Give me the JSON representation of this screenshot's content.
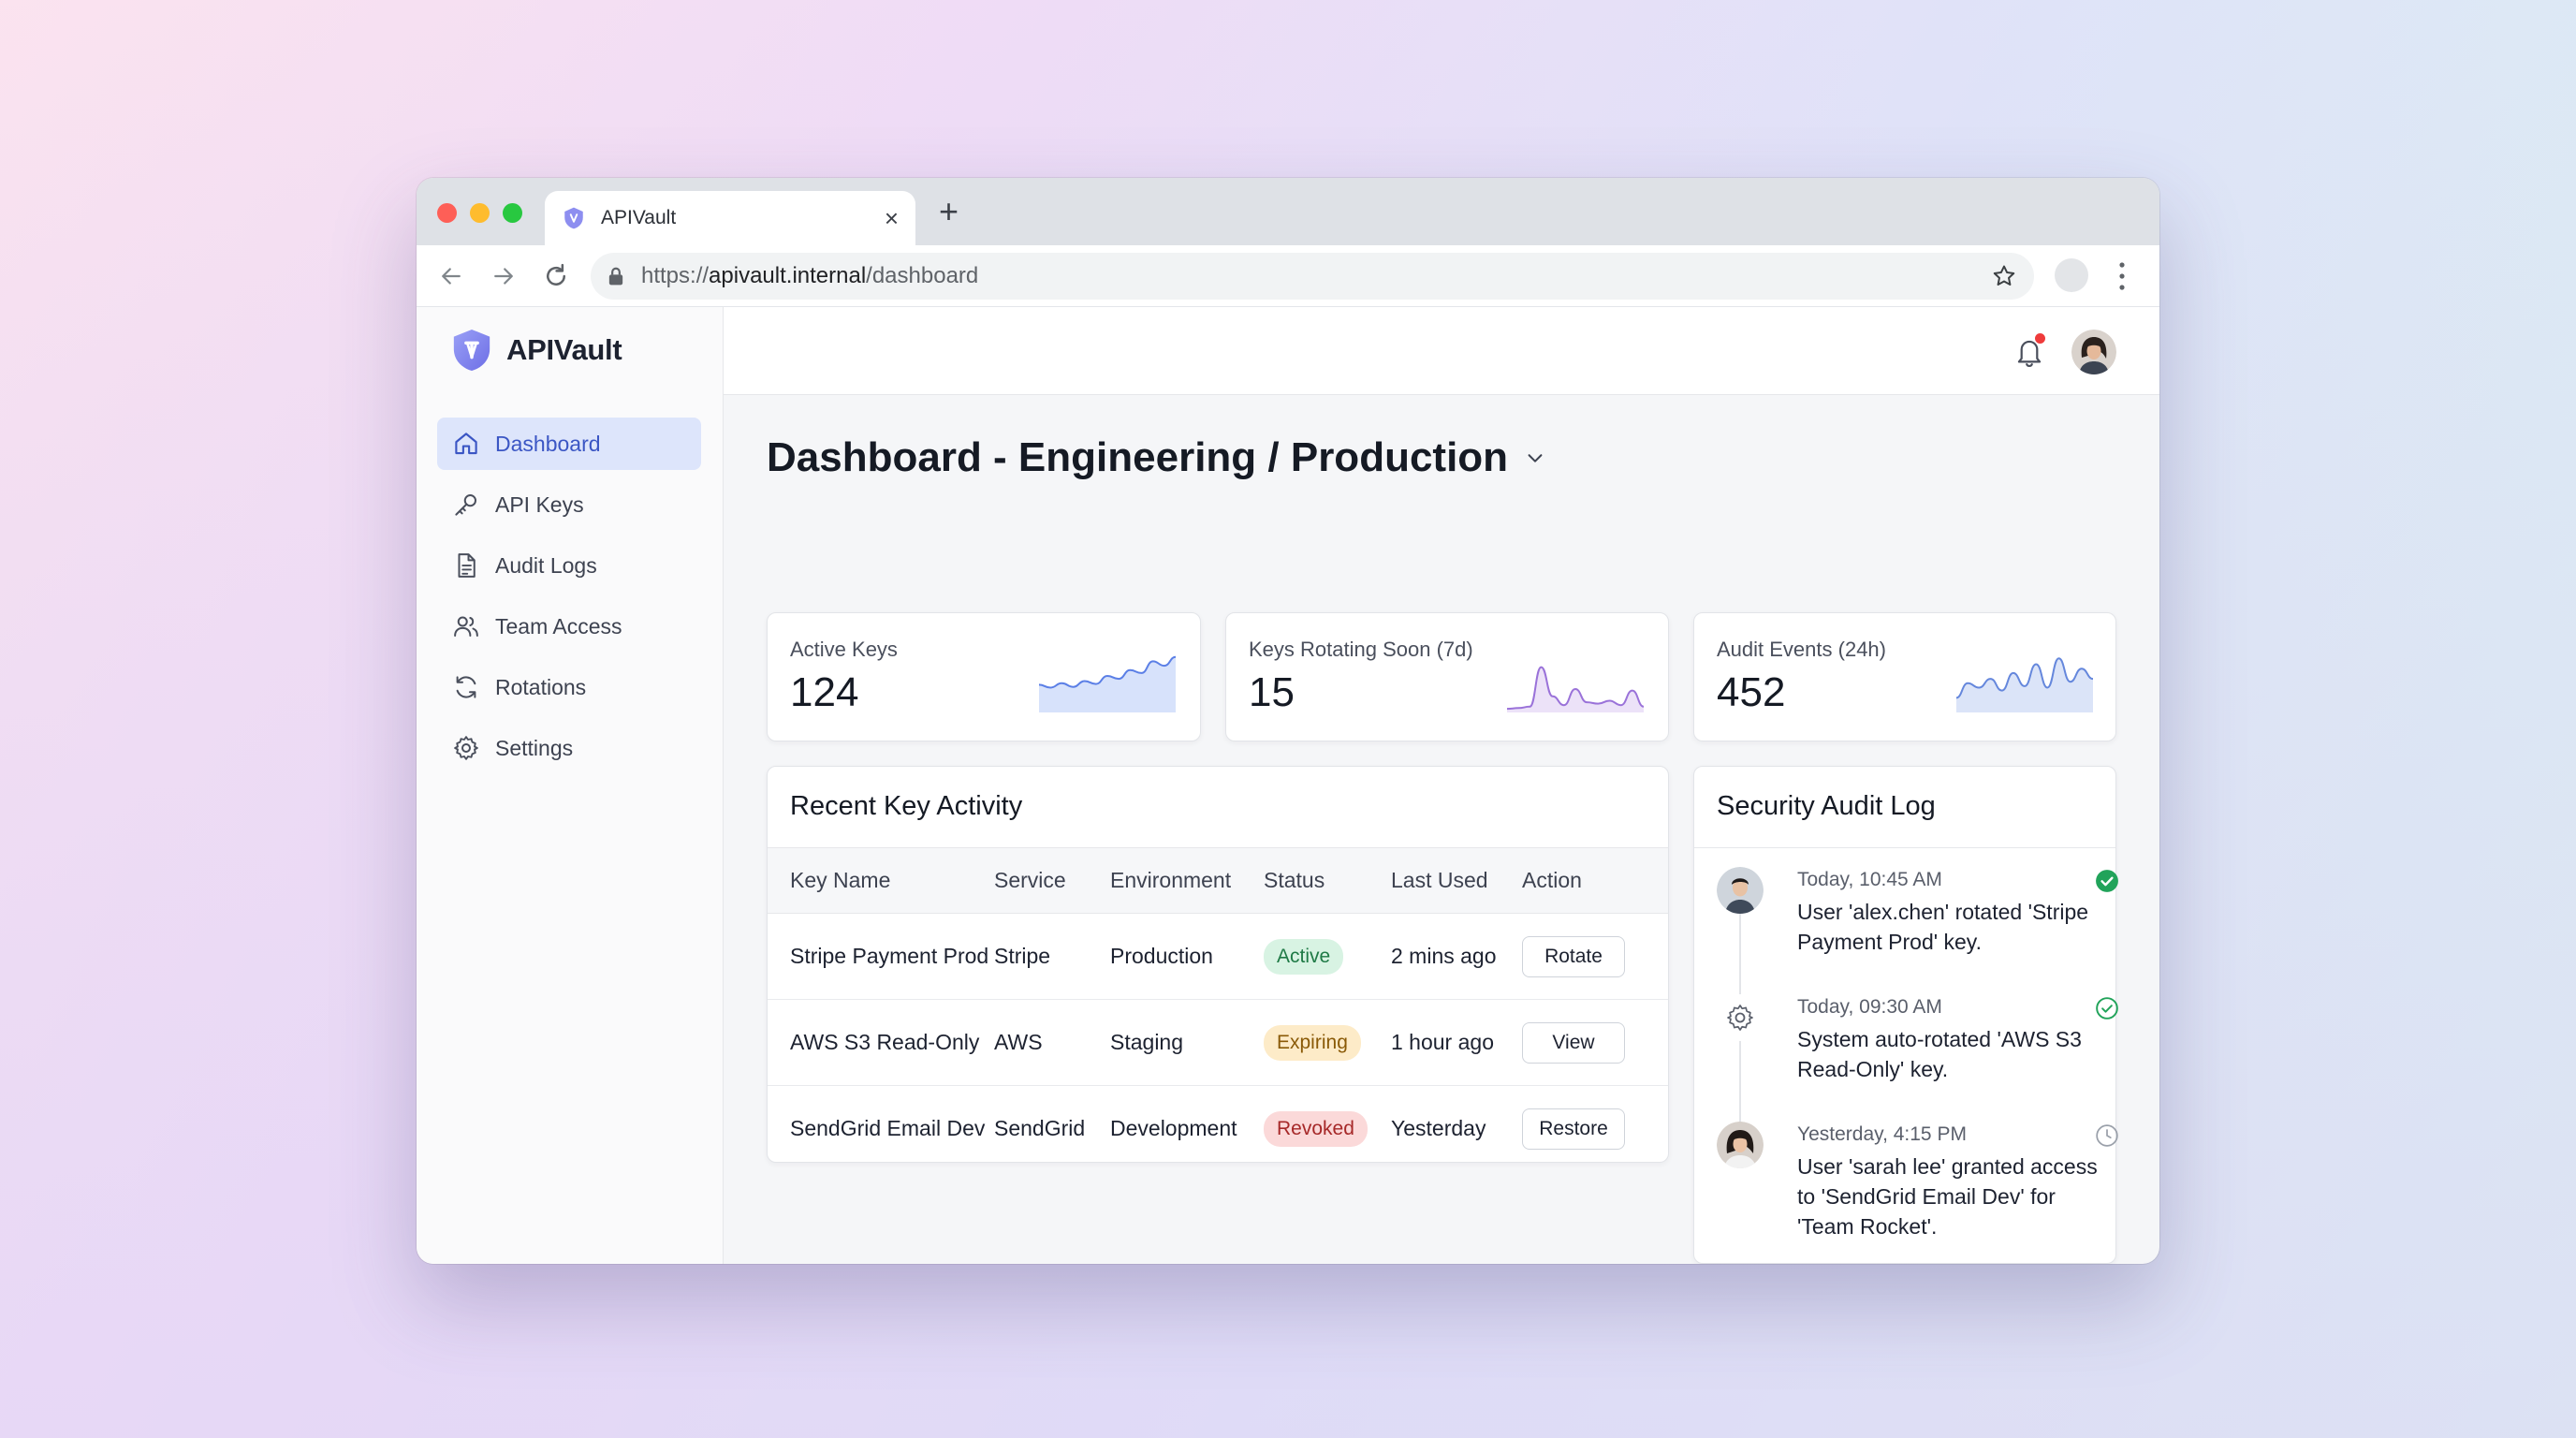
{
  "browser": {
    "tab_title": "APIVault",
    "url_scheme": "https://",
    "url_host": "apivault.internal",
    "url_path": "/dashboard"
  },
  "app": {
    "brand": "APIVault",
    "accent_color": "#3b56c4"
  },
  "sidebar": {
    "items": [
      {
        "label": "Dashboard",
        "icon": "home-icon",
        "active": true
      },
      {
        "label": "API Keys",
        "icon": "key-icon",
        "active": false
      },
      {
        "label": "Audit Logs",
        "icon": "document-icon",
        "active": false
      },
      {
        "label": "Team Access",
        "icon": "users-icon",
        "active": false
      },
      {
        "label": "Rotations",
        "icon": "refresh-icon",
        "active": false
      },
      {
        "label": "Settings",
        "icon": "gear-icon",
        "active": false
      }
    ]
  },
  "page": {
    "title": "Dashboard - Engineering / Production"
  },
  "stats": [
    {
      "label": "Active Keys",
      "value": "124",
      "trend": [
        38,
        34,
        40,
        35,
        43,
        39,
        50,
        46,
        58,
        54,
        70,
        64,
        76
      ]
    },
    {
      "label": "Keys Rotating Soon (7d)",
      "value": "15",
      "trend": [
        5,
        6,
        8,
        62,
        22,
        10,
        32,
        14,
        12,
        16,
        10,
        30,
        8
      ]
    },
    {
      "label": "Audit Events (24h)",
      "value": "452",
      "trend": [
        20,
        40,
        34,
        46,
        30,
        54,
        36,
        66,
        34,
        74,
        42,
        60,
        46
      ]
    }
  ],
  "activity": {
    "title": "Recent Key Activity",
    "columns": [
      "Key Name",
      "Service",
      "Environment",
      "Status",
      "Last Used",
      "Action"
    ],
    "rows": [
      {
        "key": "Stripe Payment Prod",
        "service": "Stripe",
        "env": "Production",
        "status": "Active",
        "status_kind": "active",
        "last": "2 mins ago",
        "action": "Rotate"
      },
      {
        "key": "AWS S3 Read-Only",
        "service": "AWS",
        "env": "Staging",
        "status": "Expiring",
        "status_kind": "expiring",
        "last": "1 hour ago",
        "action": "View"
      },
      {
        "key": "SendGrid Email Dev",
        "service": "SendGrid",
        "env": "Development",
        "status": "Revoked",
        "status_kind": "revoked",
        "last": "Yesterday",
        "action": "Restore"
      }
    ]
  },
  "audit": {
    "title": "Security Audit Log",
    "items": [
      {
        "time": "Today, 10:45 AM",
        "text": "User 'alex.chen' rotated 'Stripe Payment Prod' key.",
        "actor": "user-avatar",
        "status": "check-circle-filled-icon"
      },
      {
        "time": "Today, 09:30 AM",
        "text": "System auto-rotated 'AWS S3 Read-Only' key.",
        "actor": "gear-icon",
        "status": "check-circle-outline-icon"
      },
      {
        "time": "Yesterday, 4:15 PM",
        "text": "User 'sarah lee' granted access to 'SendGrid Email Dev' for 'Team Rocket'.",
        "actor": "user-avatar",
        "status": "clock-icon"
      }
    ]
  }
}
